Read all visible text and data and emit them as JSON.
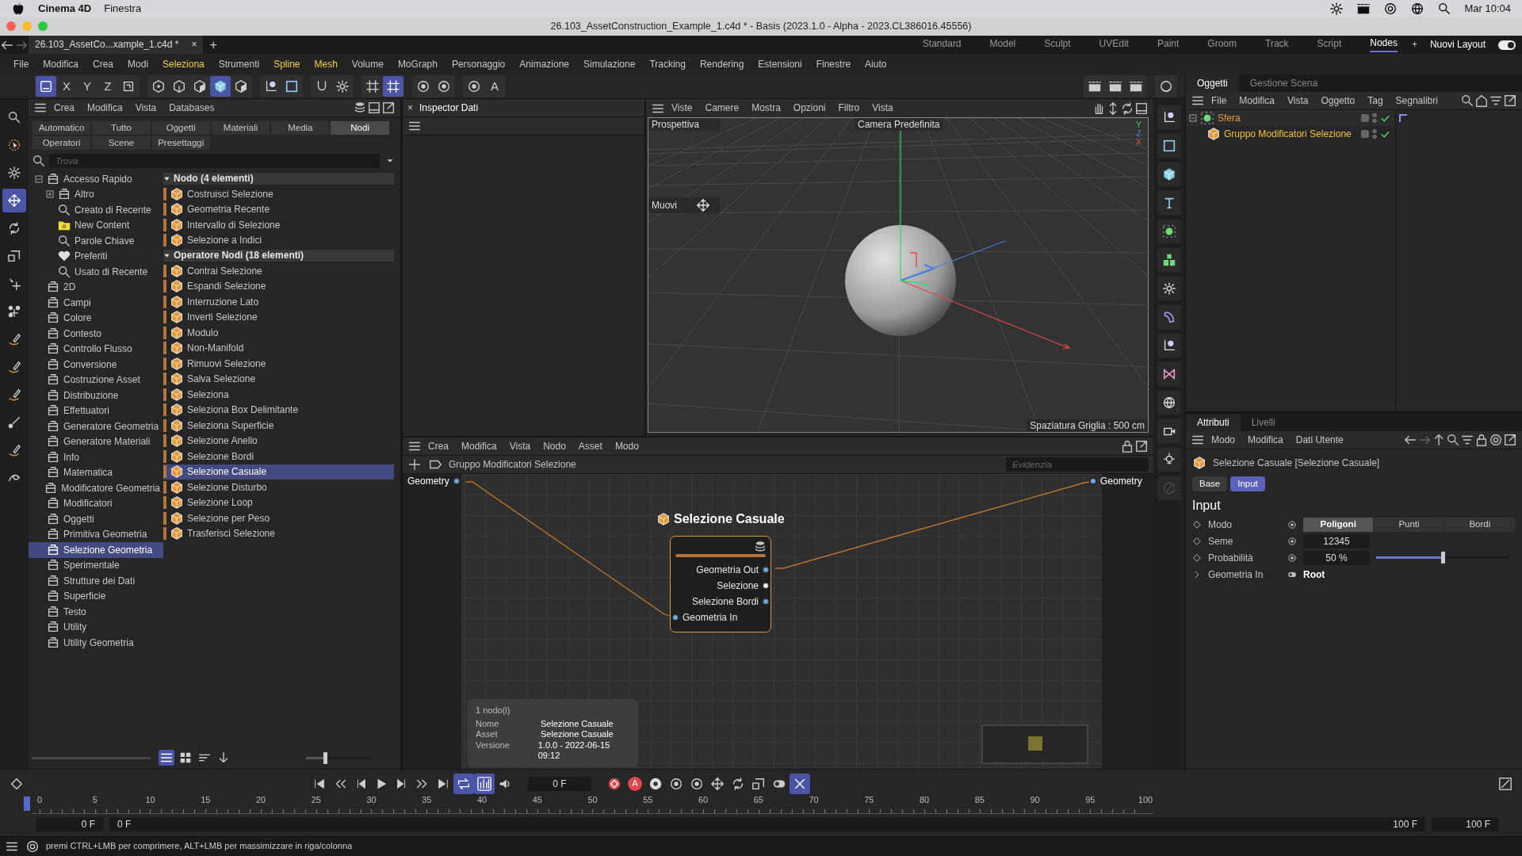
{
  "mac_menubar": {
    "app": "Cinema 4D",
    "menus": [
      "Finestra"
    ],
    "clock": "Mar 10:04"
  },
  "window": {
    "title": "26.103_AssetConstruction_Example_1.c4d * - Basis (2023.1.0 - Alpha - 2023.CL386016.45556)"
  },
  "document_tab": {
    "label": "26.103_AssetCo...xample_1.c4d *",
    "close": "×",
    "add": "+"
  },
  "layouts": [
    {
      "label": "Standard",
      "selected": false
    },
    {
      "label": "Model",
      "selected": false
    },
    {
      "label": "Sculpt",
      "selected": false
    },
    {
      "label": "UVEdit",
      "selected": false
    },
    {
      "label": "Paint",
      "selected": false
    },
    {
      "label": "Groom",
      "selected": false
    },
    {
      "label": "Track",
      "selected": false
    },
    {
      "label": "Script",
      "selected": false
    },
    {
      "label": "Nodes",
      "selected": true
    }
  ],
  "layout_add": "+",
  "layout_menu": "Nuovi Layout",
  "layout_toggle": {
    "on": true
  },
  "menu": [
    {
      "label": "File",
      "highlighted": false
    },
    {
      "label": "Modifica",
      "highlighted": false
    },
    {
      "label": "Crea",
      "highlighted": false
    },
    {
      "label": "Modi",
      "highlighted": false
    },
    {
      "label": "Seleziona",
      "highlighted": true
    },
    {
      "label": "Strumenti",
      "highlighted": false
    },
    {
      "label": "Spline",
      "highlighted": true
    },
    {
      "label": "Mesh",
      "highlighted": true
    },
    {
      "label": "Volume",
      "highlighted": false
    },
    {
      "label": "MoGraph",
      "highlighted": false
    },
    {
      "label": "Personaggio",
      "highlighted": false
    },
    {
      "label": "Animazione",
      "highlighted": false
    },
    {
      "label": "Simulazione",
      "highlighted": false
    },
    {
      "label": "Tracking",
      "highlighted": false
    },
    {
      "label": "Rendering",
      "highlighted": false
    },
    {
      "label": "Estensioni",
      "highlighted": false
    },
    {
      "label": "Finestre",
      "highlighted": false
    },
    {
      "label": "Aiuto",
      "highlighted": false
    }
  ],
  "toolbar": [
    [
      {
        "kind": "model",
        "selected": true
      },
      {
        "kind": "letter",
        "label": "X",
        "selected": false
      },
      {
        "kind": "letter",
        "label": "Y",
        "selected": false
      },
      {
        "kind": "letter",
        "label": "Z",
        "selected": false
      },
      {
        "kind": "frame",
        "selected": false
      }
    ],
    [
      {
        "kind": "points",
        "selected": false
      },
      {
        "kind": "edges",
        "selected": false
      },
      {
        "kind": "polygons",
        "selected": false
      },
      {
        "kind": "cube",
        "selected": true
      },
      {
        "kind": "uv",
        "selected": false
      }
    ],
    [
      {
        "kind": "axis",
        "selected": false
      },
      {
        "kind": "square",
        "selected": false
      }
    ],
    [
      {
        "kind": "magnet",
        "selected": false
      },
      {
        "kind": "gear",
        "selected": false
      }
    ],
    [
      {
        "kind": "grid",
        "selected": false
      },
      {
        "kind": "grid",
        "selected": true
      }
    ],
    [
      {
        "kind": "ring",
        "selected": false
      },
      {
        "kind": "ring",
        "selected": false
      }
    ],
    [
      {
        "kind": "ring",
        "selected": false
      },
      {
        "kind": "hexletter",
        "label": "A",
        "selected": false
      }
    ],
    [
      {
        "kind": "clapper",
        "selected": false
      },
      {
        "kind": "clapper",
        "selected": false
      },
      {
        "kind": "clapper",
        "selected": false
      }
    ],
    [
      {
        "kind": "render",
        "selected": false
      }
    ]
  ],
  "left_tools": [
    {
      "kind": "search",
      "selected": false
    },
    {
      "kind": "select",
      "selected": false
    },
    {
      "kind": "gear",
      "selected": false
    },
    {
      "kind": "move",
      "selected": true
    },
    {
      "kind": "rotate",
      "selected": false
    },
    {
      "kind": "scale",
      "selected": false
    },
    {
      "kind": "cursormove",
      "selected": false
    },
    {
      "kind": "cluster",
      "selected": false
    },
    {
      "kind": "pen",
      "selected": false
    },
    {
      "kind": "pen",
      "selected": false
    },
    {
      "kind": "pen",
      "selected": false
    },
    {
      "kind": "brush",
      "selected": false
    },
    {
      "kind": "pen",
      "selected": false
    },
    {
      "kind": "spiral",
      "selected": false
    }
  ],
  "right_tools": [
    {
      "kind": "axis",
      "disabled": false
    },
    {
      "kind": "square",
      "disabled": false
    },
    {
      "kind": "cube",
      "disabled": false
    },
    {
      "kind": "text",
      "disabled": false
    },
    {
      "kind": "sphere",
      "disabled": false
    },
    {
      "kind": "cubes",
      "disabled": false
    },
    {
      "kind": "gear",
      "disabled": false
    },
    {
      "kind": "blob",
      "disabled": false
    },
    {
      "kind": "axis",
      "disabled": false
    },
    {
      "kind": "bowtie",
      "disabled": false
    },
    {
      "kind": "globe",
      "disabled": false
    },
    {
      "kind": "camera",
      "disabled": false
    },
    {
      "kind": "light",
      "disabled": false
    },
    {
      "kind": "pencil",
      "disabled": true
    }
  ],
  "content_browser": {
    "menu": [
      "Crea",
      "Modifica",
      "Vista",
      "Databases"
    ],
    "tabs": [
      {
        "label": "Automatico",
        "selected": false
      },
      {
        "label": "Tutto",
        "selected": false
      },
      {
        "label": "Oggetti",
        "selected": false
      },
      {
        "label": "Materiali",
        "selected": false
      },
      {
        "label": "Media",
        "selected": false
      },
      {
        "label": "Nodi",
        "selected": true
      },
      {
        "label": "Operatori",
        "selected": false
      },
      {
        "label": "Scene",
        "selected": false
      },
      {
        "label": "Presettaggi",
        "selected": false
      }
    ],
    "search": {
      "placeholder": "Trova"
    },
    "tree": [
      {
        "label": "Accesso Rapido",
        "kind": "db",
        "expanded": true,
        "selected": false,
        "children": [
          {
            "label": "Altro",
            "kind": "db",
            "expanded": false,
            "selected": false
          },
          {
            "label": "Creato di Recente",
            "kind": "search",
            "selected": false
          },
          {
            "label": "New Content",
            "kind": "folder",
            "selected": false
          },
          {
            "label": "Parole Chiave",
            "kind": "search",
            "selected": false
          },
          {
            "label": "Preferiti",
            "kind": "heart",
            "selected": false
          },
          {
            "label": "Usato di Recente",
            "kind": "search",
            "selected": false
          }
        ]
      },
      {
        "label": "2D",
        "kind": "db",
        "selected": false
      },
      {
        "label": "Campi",
        "kind": "db",
        "selected": false
      },
      {
        "label": "Colore",
        "kind": "db",
        "selected": false
      },
      {
        "label": "Contesto",
        "kind": "db",
        "selected": false
      },
      {
        "label": "Controllo Flusso",
        "kind": "db",
        "selected": false
      },
      {
        "label": "Conversione",
        "kind": "db",
        "selected": false
      },
      {
        "label": "Costruzione Asset",
        "kind": "db",
        "selected": false
      },
      {
        "label": "Distribuzione",
        "kind": "db",
        "selected": false
      },
      {
        "label": "Effettuatori",
        "kind": "db",
        "selected": false
      },
      {
        "label": "Generatore Geometria",
        "kind": "db",
        "selected": false
      },
      {
        "label": "Generatore Materiali",
        "kind": "db",
        "selected": false
      },
      {
        "label": "Info",
        "kind": "db",
        "selected": false
      },
      {
        "label": "Matematica",
        "kind": "db",
        "selected": false
      },
      {
        "label": "Modificatore Geometria",
        "kind": "db",
        "selected": false
      },
      {
        "label": "Modificatori",
        "kind": "db",
        "selected": false
      },
      {
        "label": "Oggetti",
        "kind": "db",
        "selected": false
      },
      {
        "label": "Primitiva Geometria",
        "kind": "db",
        "selected": false
      },
      {
        "label": "Selezione Geometria",
        "kind": "db",
        "selected": true
      },
      {
        "label": "Sperimentale",
        "kind": "db",
        "selected": false
      },
      {
        "label": "Strutture dei Dati",
        "kind": "db",
        "selected": false
      },
      {
        "label": "Superficie",
        "kind": "db",
        "selected": false
      },
      {
        "label": "Testo",
        "kind": "db",
        "selected": false
      },
      {
        "label": "Utility",
        "kind": "db",
        "selected": false
      },
      {
        "label": "Utility Geometria",
        "kind": "db",
        "selected": false
      }
    ],
    "groups": [
      {
        "title": "Nodo (4 elementi)",
        "expanded": true,
        "items": [
          {
            "label": "Costruisci Selezione",
            "selected": false
          },
          {
            "label": "Geometria Recente",
            "selected": false
          },
          {
            "label": "Intervallo di Selezione",
            "selected": false
          },
          {
            "label": "Selezione a Indici",
            "selected": false
          }
        ]
      },
      {
        "title": "Operatore Nodi (18 elementi)",
        "expanded": true,
        "items": [
          {
            "label": "Contrai Selezione",
            "selected": false
          },
          {
            "label": "Espandi Selezione",
            "selected": false
          },
          {
            "label": "Interruzione Lato",
            "selected": false
          },
          {
            "label": "Inverti Selezione",
            "selected": false
          },
          {
            "label": "Modulo",
            "selected": false
          },
          {
            "label": "Non-Manifold",
            "selected": false
          },
          {
            "label": "Rimuovi Selezione",
            "selected": false
          },
          {
            "label": "Salva Selezione",
            "selected": false
          },
          {
            "label": "Seleziona",
            "selected": false
          },
          {
            "label": "Seleziona Box Delimitante",
            "selected": false
          },
          {
            "label": "Seleziona Superficie",
            "selected": false
          },
          {
            "label": "Selezione Anello",
            "selected": false
          },
          {
            "label": "Selezione Bordi",
            "selected": false
          },
          {
            "label": "Selezione Casuale",
            "selected": true
          },
          {
            "label": "Selezione Disturbo",
            "selected": false
          },
          {
            "label": "Selezione Loop",
            "selected": false
          },
          {
            "label": "Selezione per Peso",
            "selected": false
          },
          {
            "label": "Trasferisci Selezione",
            "selected": false
          }
        ]
      }
    ],
    "view_modes": [
      {
        "kind": "list",
        "selected": true
      },
      {
        "kind": "tiles",
        "selected": false
      },
      {
        "kind": "sort",
        "selected": false
      },
      {
        "kind": "down",
        "selected": false
      }
    ],
    "zoom_slider": {
      "level": 0.3
    }
  },
  "inspector": {
    "title": "Inspector Dati",
    "close": "×"
  },
  "viewport": {
    "menu": [
      "Viste",
      "Camere",
      "Mostra",
      "Opzioni",
      "Filtro",
      "Vista"
    ],
    "view_name": "Prospettiva",
    "camera": "Camera Predefinita",
    "tool": "Muovi",
    "axis_labels": [
      "Y",
      "Z",
      "X"
    ],
    "grid_spacing": "Spaziatura Griglia : 500 cm"
  },
  "node_editor": {
    "menu": [
      "Crea",
      "Modifica",
      "Vista",
      "Nodo",
      "Asset",
      "Modo"
    ],
    "breadcrumb": "Gruppo Modificatori Selezione",
    "search": {
      "placeholder": "Evidenzia"
    },
    "input_port": "Geometry",
    "output_port": "Geometry",
    "node": {
      "title": "Selezione Casuale",
      "ports": [
        {
          "label": "Geometria Out",
          "output": true,
          "kind": "geometry"
        },
        {
          "label": "Selezione",
          "output": true,
          "kind": "selection"
        },
        {
          "label": "Selezione Bordi",
          "output": true,
          "kind": "geometry"
        },
        {
          "label": "Geometria In",
          "output": false,
          "kind": "geometry"
        }
      ]
    },
    "info": {
      "heading": "1 nodo(i)",
      "rows": [
        {
          "label": "Nome",
          "value": "Selezione Casuale"
        },
        {
          "label": "Asset",
          "value": "Selezione Casuale"
        },
        {
          "label": "Versione",
          "value": "1.0.0 - 2022-06-15 09:12"
        }
      ]
    }
  },
  "objects": {
    "tabs": [
      {
        "label": "Oggetti",
        "selected": true
      },
      {
        "label": "Gestione Scena",
        "selected": false
      }
    ],
    "menu": [
      "File",
      "Modifica",
      "Vista",
      "Oggetto",
      "Tag",
      "Segnalibri"
    ],
    "tree": [
      {
        "label": "Sfera",
        "kind": "sphere",
        "color": "#e39a3a",
        "expanded": true,
        "enabled": true,
        "children": [
          {
            "label": "Gruppo Modificatori Selezione",
            "kind": "nodecube",
            "color": "#f2c33c",
            "enabled": true
          }
        ]
      }
    ]
  },
  "attributes": {
    "tabs": [
      {
        "label": "Attributi",
        "selected": true
      },
      {
        "label": "Livelli",
        "selected": false
      }
    ],
    "menu": [
      "Modo",
      "Modifica",
      "Dati Utente"
    ],
    "title": "Selezione Casuale [Selezione Casuale]",
    "subtabs": [
      {
        "label": "Base",
        "selected": false
      },
      {
        "label": "Input",
        "selected": true
      }
    ],
    "section": "Input",
    "params": [
      {
        "label": "Modo",
        "kind": "segmented",
        "options": [
          {
            "label": "Poligoni",
            "selected": true
          },
          {
            "label": "Punti",
            "selected": false
          },
          {
            "label": "Bordi",
            "selected": false
          }
        ]
      },
      {
        "label": "Seme",
        "kind": "number",
        "value": "12345"
      },
      {
        "label": "Probabilità",
        "kind": "slider",
        "value": "50 %",
        "level": 0.5
      },
      {
        "label": "Geometria In",
        "kind": "link",
        "value": "Root"
      }
    ]
  },
  "timeline": {
    "current_frame": "0 F",
    "ticks": [
      "0",
      "5",
      "10",
      "15",
      "20",
      "25",
      "30",
      "35",
      "40",
      "45",
      "50",
      "55",
      "60",
      "65",
      "70",
      "75",
      "80",
      "85",
      "90",
      "95",
      "100"
    ],
    "playhead": {
      "level": 0
    },
    "range": [
      "0 F",
      "0 F",
      "100 F",
      "100 F"
    ],
    "transport": [
      {
        "kind": "first",
        "selected": false
      },
      {
        "kind": "prevkey",
        "selected": false
      },
      {
        "kind": "prev",
        "selected": false
      },
      {
        "kind": "play",
        "selected": false
      },
      {
        "kind": "next",
        "selected": false
      },
      {
        "kind": "nextkey",
        "selected": false
      },
      {
        "kind": "last",
        "selected": false
      },
      {
        "kind": "loop",
        "selected": true
      },
      {
        "kind": "audio",
        "selected": true
      },
      {
        "kind": "speaker",
        "selected": false
      }
    ],
    "record": [
      {
        "kind": "record",
        "selected": false
      },
      {
        "kind": "autokey",
        "label": "A",
        "selected": false
      },
      {
        "kind": "gearcircle",
        "selected": false
      },
      {
        "kind": "ring",
        "selected": false
      },
      {
        "kind": "ring",
        "selected": false
      },
      {
        "kind": "move",
        "selected": false
      },
      {
        "kind": "rotate",
        "selected": false
      },
      {
        "kind": "scale",
        "selected": false
      },
      {
        "kind": "toggle",
        "selected": false
      },
      {
        "kind": "scissors",
        "selected": true
      }
    ]
  },
  "status_bar": {
    "text": "premi CTRL+LMB per comprimere, ALT+LMB per massimizzare in riga/colonna"
  }
}
